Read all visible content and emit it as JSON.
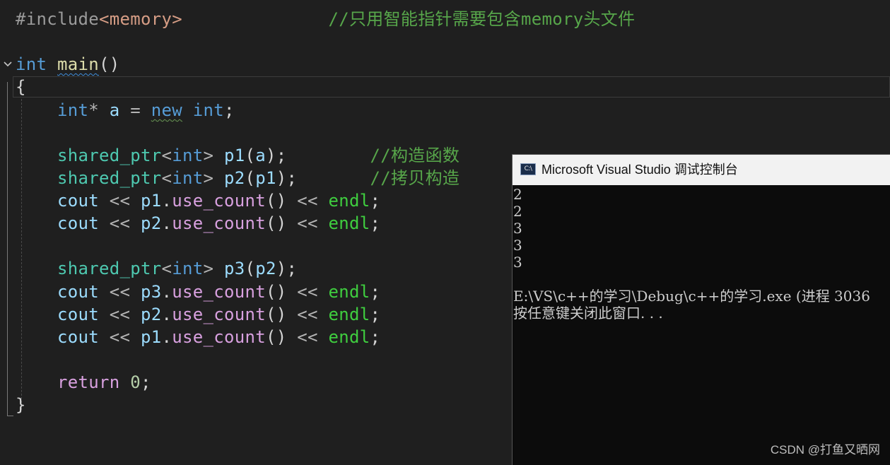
{
  "editor": {
    "include": {
      "directive": "#include",
      "header": "<memory>",
      "comment": "//只用智能指针需要包含memory头文件"
    },
    "main_sig": {
      "kw": "int",
      "name": "main",
      "paren": "()"
    },
    "open_brace": "{",
    "close_brace": "}",
    "line_new": {
      "kw": "int",
      "star": "*",
      "var": "a",
      "eq": "=",
      "new": "new",
      "kw2": "int",
      "semi": ";"
    },
    "line_p1": {
      "type": "shared_ptr",
      "targ_open": "<",
      "targ": "int",
      "targ_close": ">",
      "var": "p1",
      "args_open": "(",
      "arg": "a",
      "args_close": ");",
      "comment": "//构造函数"
    },
    "line_p2": {
      "type": "shared_ptr",
      "targ_open": "<",
      "targ": "int",
      "targ_close": ">",
      "var": "p2",
      "args_open": "(",
      "arg": "p1",
      "args_close": ");",
      "comment": "//拷贝构造"
    },
    "line_p3": {
      "type": "shared_ptr",
      "targ_open": "<",
      "targ": "int",
      "targ_close": ">",
      "var": "p3",
      "args_open": "(",
      "arg": "p2",
      "args_close": ");"
    },
    "cout_lines": [
      {
        "cout": "cout",
        "op": "<<",
        "obj": "p1",
        "dot": ".",
        "method": "use_count",
        "call": "()",
        "op2": "<<",
        "endl": "endl",
        "semi": ";"
      },
      {
        "cout": "cout",
        "op": "<<",
        "obj": "p2",
        "dot": ".",
        "method": "use_count",
        "call": "()",
        "op2": "<<",
        "endl": "endl",
        "semi": ";"
      },
      {
        "cout": "cout",
        "op": "<<",
        "obj": "p3",
        "dot": ".",
        "method": "use_count",
        "call": "()",
        "op2": "<<",
        "endl": "endl",
        "semi": ";"
      },
      {
        "cout": "cout",
        "op": "<<",
        "obj": "p2",
        "dot": ".",
        "method": "use_count",
        "call": "()",
        "op2": "<<",
        "endl": "endl",
        "semi": ";"
      },
      {
        "cout": "cout",
        "op": "<<",
        "obj": "p1",
        "dot": ".",
        "method": "use_count",
        "call": "()",
        "op2": "<<",
        "endl": "endl",
        "semi": ";"
      }
    ],
    "return_line": {
      "kw": "return",
      "value": "0",
      "semi": ";"
    }
  },
  "console": {
    "title": "Microsoft Visual Studio 调试控制台",
    "icon_text": "C:\\",
    "output": [
      "2",
      "2",
      "3",
      "3",
      "3",
      "",
      "E:\\VS\\c++的学习\\Debug\\c++的学习.exe (进程 3036",
      "按任意键关闭此窗口. . ."
    ]
  },
  "watermark": "CSDN @打鱼又晒网",
  "colors": {
    "editor_bg": "#1f1f1f",
    "keyword": "#569cd6",
    "comment": "#57a64a",
    "type": "#4ec9b0",
    "variable": "#9cdcfe",
    "function": "#dcdcaa",
    "macro": "#3fcd3f",
    "console_bg": "#0c0c0c"
  }
}
